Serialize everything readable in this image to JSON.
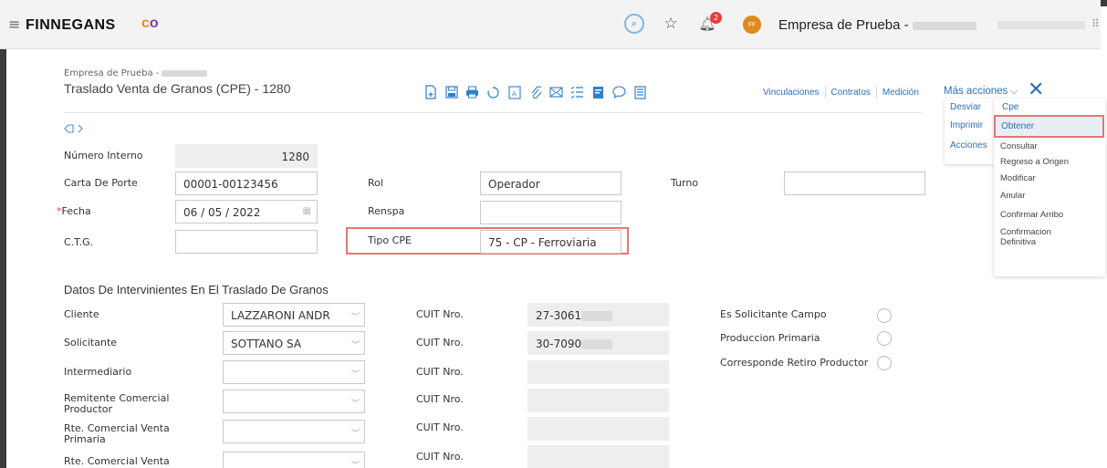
{
  "topbar": {
    "brand": "FINNEGANS",
    "brand_mark_c": "c",
    "brand_mark_o": "o",
    "notifications_count": "2",
    "avatar_initials": "FF",
    "company": "Empresa de Prueba -"
  },
  "header": {
    "breadcrumb": "Empresa de Prueba -",
    "title": "Traslado Venta de Granos (CPE) - 1280",
    "toolbar_icons": [
      "new-doc-icon",
      "save-icon",
      "print-icon",
      "history-icon",
      "pdf-icon",
      "attach-icon",
      "mail-icon",
      "checklist-icon",
      "document-icon",
      "comment-icon",
      "list-icon"
    ],
    "links": [
      "Vinculaciones",
      "Contratos",
      "Medición"
    ],
    "more_actions": "Más acciones"
  },
  "menu": {
    "left": [
      "Desviar",
      "Imprimir",
      "Acciones"
    ],
    "right_header": "Cpe",
    "right_items": [
      "Obtener",
      "Consultar",
      "Regreso a Origen",
      "Modificar",
      "Anular",
      "Confirmar Arribo",
      "Confirmacion Definitiva"
    ]
  },
  "form": {
    "numero_interno_label": "Número Interno",
    "numero_interno": "1280",
    "carta_de_porte_label": "Carta De Porte",
    "carta_de_porte": "00001-00123456",
    "fecha_label": "Fecha",
    "fecha": "06 / 05 / 2022",
    "ctg_label": "C.T.G.",
    "ctg": "",
    "rol_label": "Rol",
    "rol": "Operador",
    "renspa_label": "Renspa",
    "renspa": "",
    "tipo_cpe_label": "Tipo CPE",
    "tipo_cpe": "75 - CP - Ferroviaria",
    "turno_label": "Turno",
    "turno": ""
  },
  "intervinientes": {
    "title": "Datos De Intervinientes En El Traslado De Granos",
    "rows": [
      {
        "label": "Cliente",
        "value": "LAZZARONI ANDR",
        "cuit_label": "CUIT Nro.",
        "cuit": "27-3061"
      },
      {
        "label": "Solicitante",
        "value": "SOTTANO SA",
        "cuit_label": "CUIT Nro.",
        "cuit": "30-7090"
      },
      {
        "label": "Intermediario",
        "value": "",
        "cuit_label": "CUIT Nro.",
        "cuit": ""
      },
      {
        "label": "Remitente Comercial Productor",
        "value": "",
        "cuit_label": "CUIT Nro.",
        "cuit": ""
      },
      {
        "label": "Rte. Comercial Venta Primaria",
        "value": "",
        "cuit_label": "CUIT Nro.",
        "cuit": ""
      },
      {
        "label": "Rte. Comercial Venta",
        "value": "",
        "cuit_label": "CUIT Nro.",
        "cuit": ""
      }
    ],
    "checks": [
      "Es Solicitante Campo",
      "Produccion Primaria",
      "Corresponde Retiro Productor"
    ]
  }
}
